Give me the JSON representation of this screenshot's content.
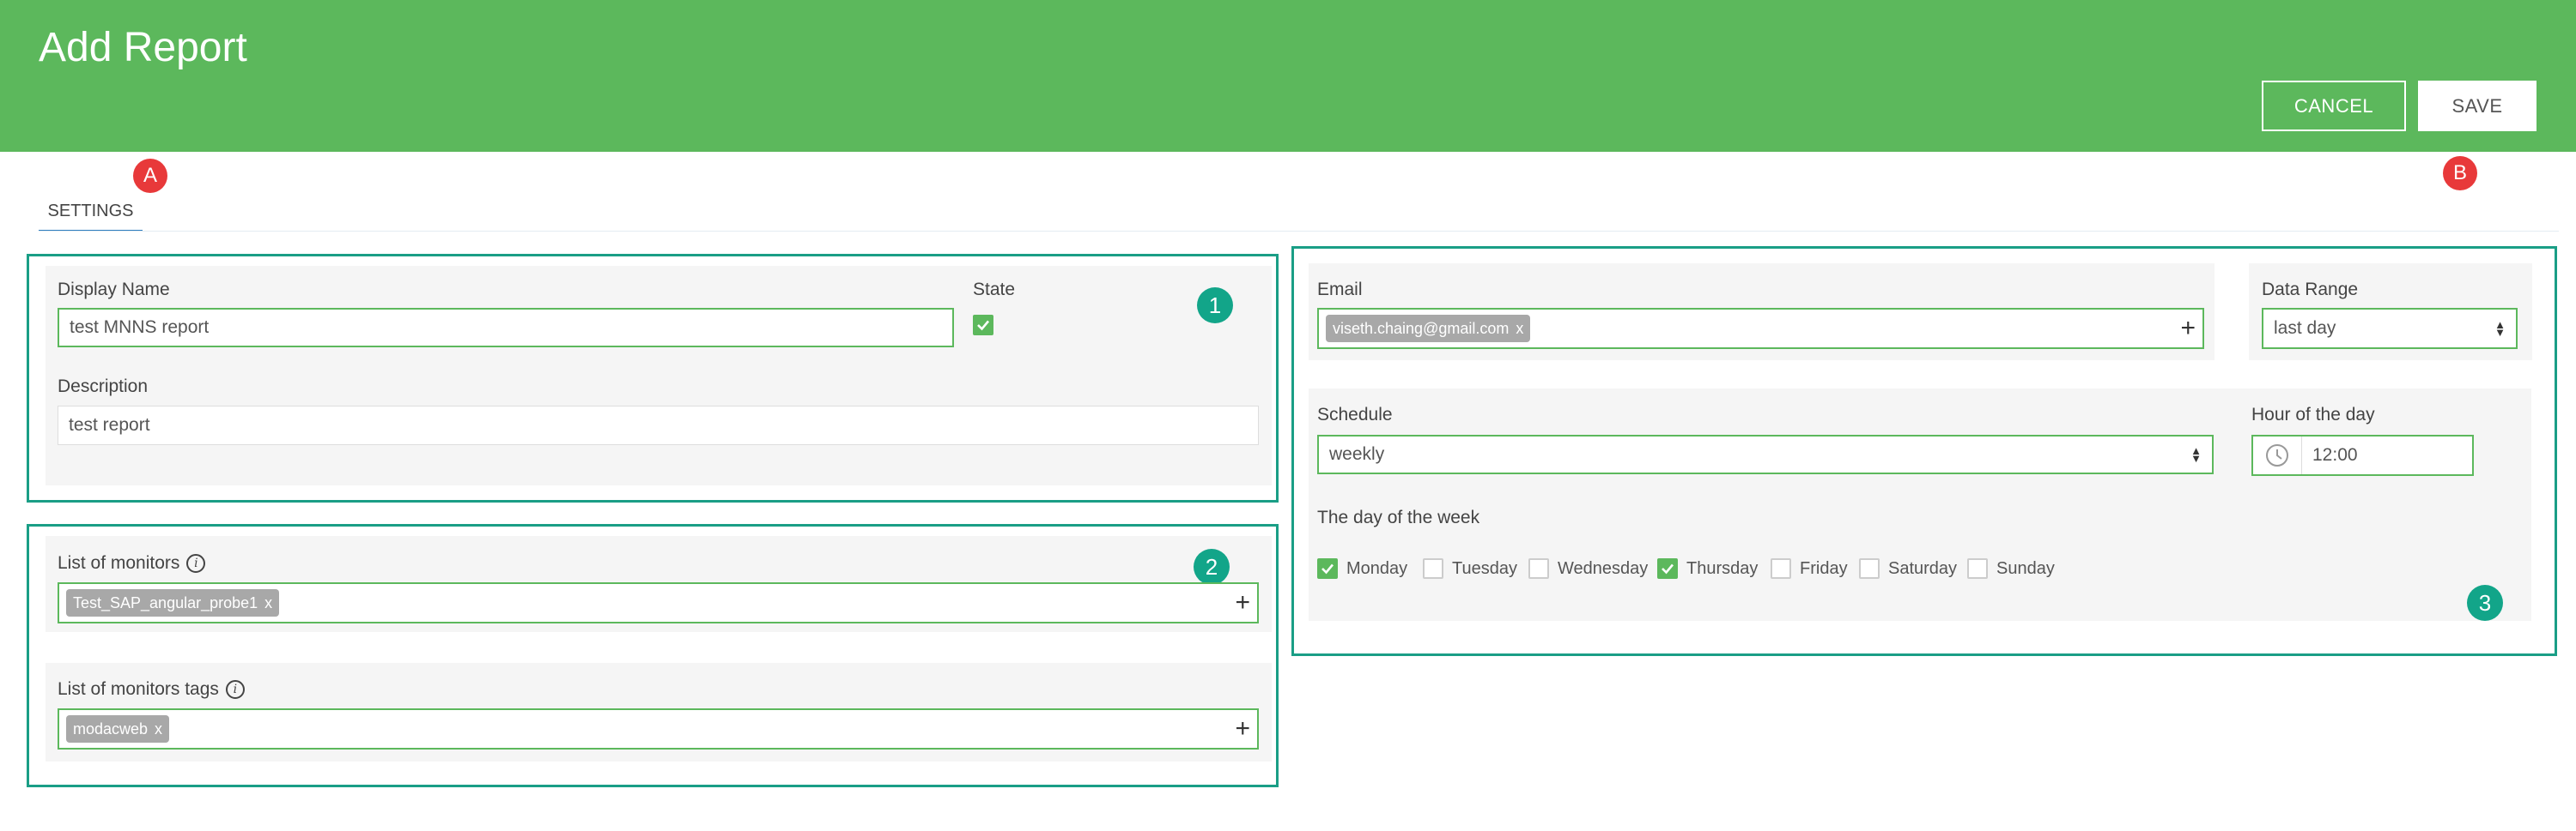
{
  "header": {
    "title": "Add Report",
    "cancel_label": "CANCEL",
    "save_label": "SAVE",
    "background_color": "#5cb85c"
  },
  "markers": {
    "a": "A",
    "b": "B",
    "one": "1",
    "two": "2",
    "three": "3"
  },
  "tabs": [
    {
      "label": "SETTINGS",
      "active": true
    }
  ],
  "general": {
    "display_name_label": "Display Name",
    "display_name_value": "test MNNS report",
    "state_label": "State",
    "state_checked": true,
    "description_label": "Description",
    "description_value": "test report"
  },
  "monitors": {
    "list_label": "List of monitors",
    "list_tag": "Test_SAP_angular_probe1",
    "tags_label": "List of monitors tags",
    "tags_tag": "modacweb",
    "tag_remove": "x",
    "add_symbol": "+"
  },
  "schedule": {
    "email_label": "Email",
    "email_tag": "viseth.chaing@gmail.com",
    "data_range_label": "Data Range",
    "data_range_value": "last day",
    "schedule_label": "Schedule",
    "schedule_value": "weekly",
    "hour_label": "Hour of the day",
    "hour_value": "12:00",
    "day_of_week_label": "The day of the week",
    "days": [
      {
        "label": "Monday",
        "checked": true
      },
      {
        "label": "Tuesday",
        "checked": false
      },
      {
        "label": "Wednesday",
        "checked": false
      },
      {
        "label": "Thursday",
        "checked": true
      },
      {
        "label": "Friday",
        "checked": false
      },
      {
        "label": "Saturday",
        "checked": false
      },
      {
        "label": "Sunday",
        "checked": false
      }
    ]
  },
  "colors": {
    "accent": "#5cb85c",
    "annotation_box": "#1a9e86",
    "marker_red": "#e8393a",
    "marker_green": "#12a589",
    "tab_underline": "#2e7dbe"
  }
}
